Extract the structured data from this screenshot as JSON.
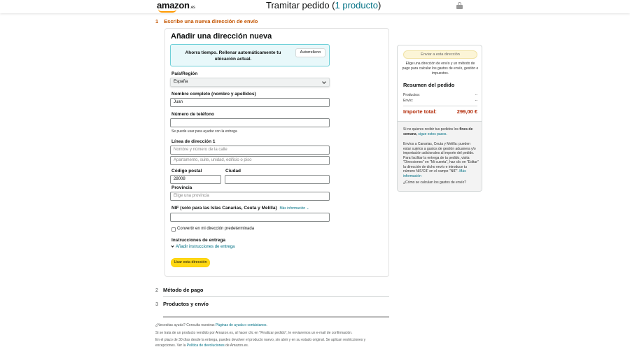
{
  "header": {
    "logo": "amazon",
    "logo_tld": ".es",
    "title_prefix": "Tramitar pedido (",
    "title_count": "1 producto",
    "title_suffix": ")"
  },
  "step1": {
    "num": "1",
    "title": "Escribe una nueva dirección de envío"
  },
  "form": {
    "title": "Añadir una dirección nueva",
    "autofill_text": "Ahorra tiempo. Rellenar automáticamente tu ubicación actual.",
    "autofill_button": "Autorrelleno",
    "country_label": "País/Región",
    "country_value": "España",
    "name_label": "Nombre completo (nombre y apellidos)",
    "name_value": "Juan",
    "phone_label": "Número de teléfono",
    "phone_value": "",
    "phone_hint": "Se puede usar para ayudar con la entrega",
    "address_label": "Línea de dirección 1",
    "address1_placeholder": "Nombre y número de la calle",
    "address2_placeholder": "Apartamento, suite, unidad, edificio o piso",
    "postal_label": "Código postal",
    "postal_value": "28008",
    "city_label": "Ciudad",
    "city_value": "",
    "province_label": "Provincia",
    "province_placeholder": "Elige una provincia",
    "nif_label": "NIF (solo para las Islas Canarias, Ceuta y Melilla)",
    "nif_link": "Más información ⌄",
    "nif_value": "",
    "default_checkbox": "Convertir en mi dirección predeterminada",
    "instructions_label": "Instrucciones de entrega",
    "instructions_link": "Añadir instrucciones de entrega",
    "use_button": "Usar esta dirección"
  },
  "sections": [
    {
      "num": "2",
      "title": "Método de pago"
    },
    {
      "num": "3",
      "title": "Productos y envío"
    }
  ],
  "footer": {
    "help_prefix": "¿Necesitas ayuda? Consulta nuestras ",
    "help_link": "Páginas de ayuda o contáctanos",
    "help_suffix": ".",
    "line2": "Si se trata de un producto vendido por Amazon.es, al hacer clic en \"Finalizar pedido\", te enviaremos un e-mail de confirmación.",
    "line3_prefix": "En el plazo de 30 días desde la entrega, puedes devolver el producto nuevo, sin abrir y en su estado original. Se aplican restricciones y excepciones. Ver la ",
    "line3_link": "Política de devoluciones",
    "line3_suffix": " de Amazon.es."
  },
  "sidebar": {
    "ship_button": "Enviar a esta dirección",
    "description": "Elige una dirección de envío y un método de pago para calcular los gastos de envío, gestión e impuestos.",
    "summary_title": "Resumen del pedido",
    "products_label": "Productos:",
    "products_value": "--",
    "shipping_label": "Envío:",
    "shipping_value": "--",
    "total_label": "Importe total:",
    "total_value": "299,00 €",
    "weekend_prefix": "Si no quieres recibir tus pedidos los ",
    "weekend_bold": "fines de semana",
    "weekend_suffix": ", ",
    "weekend_link": "sigue estos pasos.",
    "canarias_text": "Envíos a Canarias, Ceuta y Melilla: pueden estar sujetos a gastos de gestión aduanera y/o importación adicionales al importe del pedido. Para facilitar la entrega de tu pedido, visita \"Direcciones\" en \"Mi cuenta\", haz clic en \"Editar\" la dirección de dicho envío e introduce tu número NIF/CIF en el campo \"NIF\".",
    "canarias_link": "Más información",
    "shipping_cost_link": "¿Cómo se calculan los gastos de envío?"
  }
}
